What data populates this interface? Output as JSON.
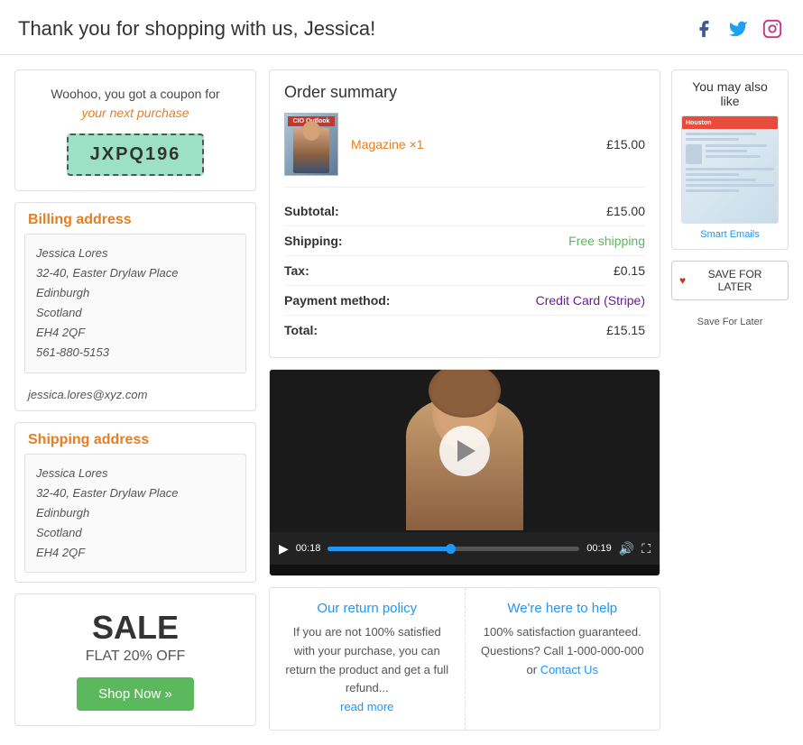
{
  "header": {
    "title": "Thank you for shopping with us, Jessica!",
    "social": {
      "facebook_label": "Facebook",
      "twitter_label": "Twitter",
      "instagram_label": "Instagram"
    }
  },
  "coupon": {
    "text_1": "Woohoo, you got a coupon for",
    "text_2": "your next purchase",
    "code": "JXPQ196"
  },
  "billing": {
    "title": "Billing address",
    "name": "Jessica Lores",
    "address1": "32-40, Easter Drylaw Place",
    "city": "Edinburgh",
    "region": "Scotland",
    "postcode": "EH4 2QF",
    "phone": "561-880-5153",
    "email": "jessica.lores@xyz.com"
  },
  "shipping": {
    "title": "Shipping address",
    "name": "Jessica Lores",
    "address1": "32-40, Easter Drylaw Place",
    "city": "Edinburgh",
    "region": "Scotland",
    "postcode": "EH4 2QF"
  },
  "sale": {
    "title": "SALE",
    "subtitle": "FLAT 20% OFF",
    "button": "Shop Now »"
  },
  "order_summary": {
    "title": "Order summary",
    "item_name": "Magazine ×1",
    "item_price": "£15.00",
    "subtotal_label": "Subtotal:",
    "subtotal_value": "£15.00",
    "shipping_label": "Shipping:",
    "shipping_value": "Free shipping",
    "tax_label": "Tax:",
    "tax_value": "£0.15",
    "payment_label": "Payment method:",
    "payment_value": "Credit Card (Stripe)",
    "total_label": "Total:",
    "total_value": "£15.15"
  },
  "video": {
    "time_elapsed": "00:18",
    "time_total": "00:19"
  },
  "return_policy": {
    "title": "Our return policy",
    "text": "If you are not 100% satisfied with your purchase, you can return the product and get a full refund...",
    "read_more": "read more"
  },
  "help": {
    "title": "We're here to help",
    "text": "100% satisfaction guaranteed. Questions? Call 1-000-000-000 or",
    "contact_link": "Contact Us"
  },
  "upsell": {
    "title": "You may also like",
    "product_label": "Smart Emails",
    "save_btn": "SAVE FOR LATER",
    "save_label": "Save For Later"
  }
}
